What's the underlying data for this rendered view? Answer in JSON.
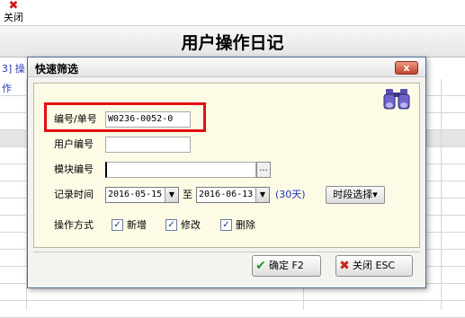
{
  "toolbar": {
    "close_icon": "close-x-icon",
    "close_label": "关闭"
  },
  "page": {
    "title": "用户操作日记",
    "left_strip_text": "3] 操作"
  },
  "dialog": {
    "title": "快速筛选",
    "close_symbol": "x",
    "fields": {
      "number": {
        "label": "编号/单号",
        "value": "W0236-0052-0"
      },
      "user_id": {
        "label": "用户编号",
        "value": ""
      },
      "module_id": {
        "label": "模块编号",
        "value": "",
        "button": "..."
      },
      "record_time": {
        "label": "记录时间",
        "from": "2016-05-15",
        "to_label": "至",
        "to": "2016-06-13",
        "days": "(30天)",
        "period_button": "时段选择"
      },
      "operation": {
        "label": "操作方式",
        "options": [
          {
            "label": "新增",
            "checked": true
          },
          {
            "label": "修改",
            "checked": true
          },
          {
            "label": "删除",
            "checked": true
          }
        ]
      }
    },
    "buttons": {
      "confirm": "确定 F2",
      "close": "关闭 ESC"
    },
    "colors": {
      "highlight": "#e31010",
      "days_text": "#1d33c4",
      "panel": "#fdfbe6"
    }
  }
}
